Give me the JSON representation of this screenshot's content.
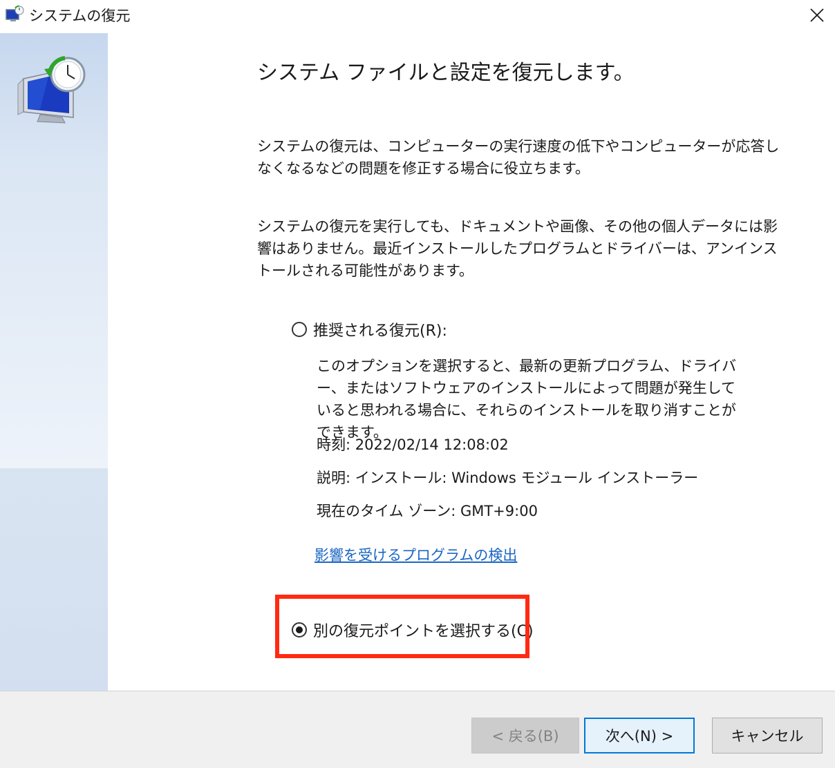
{
  "window": {
    "title": "システムの復元",
    "close_icon": "close-icon"
  },
  "main": {
    "heading": "システム ファイルと設定を復元します。",
    "paragraph1": "システムの復元は、コンピューターの実行速度の低下やコンピューターが応答しなくなるなどの問題を修正する場合に役立ちます。",
    "paragraph2": "システムの復元を実行しても、ドキュメントや画像、その他の個人データには影響はありません。最近インストールしたプログラムとドライバーは、アンインストールされる可能性があります。"
  },
  "options": {
    "recommended": {
      "label": "推奨される復元(R):",
      "checked": false,
      "description": "このオプションを選択すると、最新の更新プログラム、ドライバー、またはソフトウェアのインストールによって問題が発生していると思われる場合に、それらのインストールを取り消すことができます。",
      "time": "時刻: 2022/02/14 12:08:02",
      "desc_line": "説明: インストール: Windows モジュール インストーラー",
      "timezone": "現在のタイム ゾーン: GMT+9:00",
      "link": "影響を受けるプログラムの検出"
    },
    "other": {
      "label": "別の復元ポイントを選択する(C)",
      "checked": true
    }
  },
  "highlight_color": "#ff2a12",
  "buttons": {
    "back": "< 戻る(B)",
    "next": "次へ(N) >",
    "cancel": "キャンセル"
  }
}
